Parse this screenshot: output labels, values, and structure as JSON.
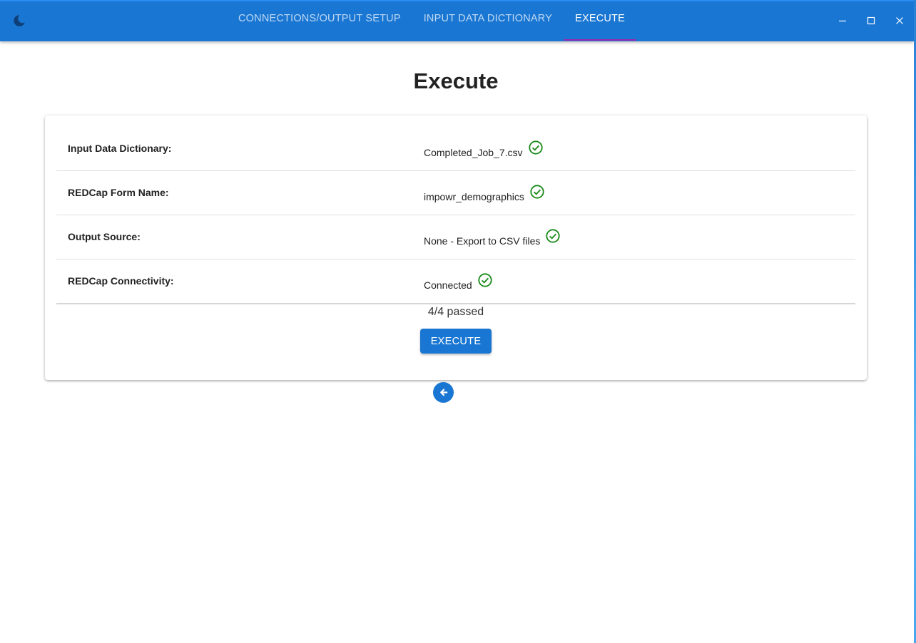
{
  "header": {
    "theme_icon": "moon-icon",
    "tabs": [
      {
        "label": "CONNECTIONS/OUTPUT SETUP",
        "active": false
      },
      {
        "label": "INPUT DATA DICTIONARY",
        "active": false
      },
      {
        "label": "EXECUTE",
        "active": true
      }
    ],
    "window_controls": [
      "minimize-icon",
      "maximize-icon",
      "close-icon"
    ]
  },
  "main": {
    "title": "Execute",
    "checks": [
      {
        "label": "Input Data Dictionary:",
        "value": "Completed_Job_7.csv",
        "status_icon": "check-circle-icon"
      },
      {
        "label": "REDCap Form Name:",
        "value": "impowr_demographics",
        "status_icon": "check-circle-icon"
      },
      {
        "label": "Output Source:",
        "value": "None - Export to CSV files",
        "status_icon": "check-circle-icon"
      },
      {
        "label": "REDCap Connectivity:",
        "value": "Connected",
        "status_icon": "check-circle-icon"
      }
    ],
    "summary": "4/4 passed",
    "execute_label": "EXECUTE",
    "back_icon": "arrow-left-icon"
  },
  "colors": {
    "primary": "#1976d2",
    "tab_indicator": "#9c27b0",
    "success": "#1a8a1a"
  }
}
